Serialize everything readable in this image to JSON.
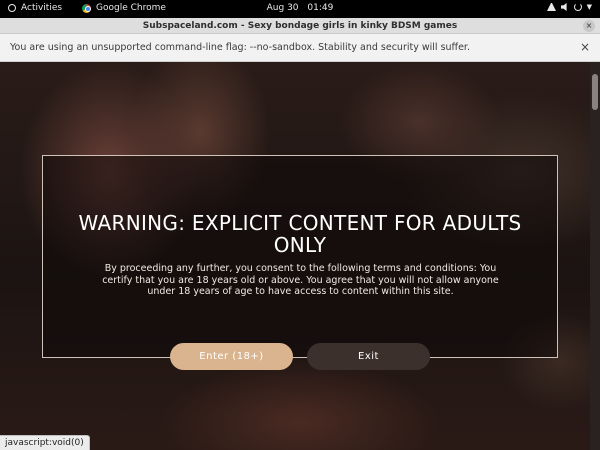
{
  "topbar": {
    "activities": "Activities",
    "app_name": "Google Chrome",
    "date": "Aug 30",
    "time": "01:49"
  },
  "window": {
    "title": "Subspaceland.com - Sexy bondage girls in kinky BDSM games",
    "close_glyph": "×"
  },
  "infobar": {
    "message": "You are using an unsupported command-line flag: --no-sandbox. Stability and security will suffer.",
    "close_glyph": "×"
  },
  "modal": {
    "heading": "WARNING: EXPLICIT CONTENT FOR ADULTS ONLY",
    "body": "By proceeding any further, you consent to the following terms and conditions: You certify that you are 18 years old or above. You agree that you will not allow anyone under 18 years of age to have access to content within this site.",
    "enter_label": "Enter (18+)",
    "exit_label": "Exit"
  },
  "statusbar": {
    "text": "javascript:void(0)"
  },
  "colors": {
    "enter_button": "#d9b48f",
    "exit_button": "#3c302c",
    "modal_border": "#cfc2b8"
  }
}
